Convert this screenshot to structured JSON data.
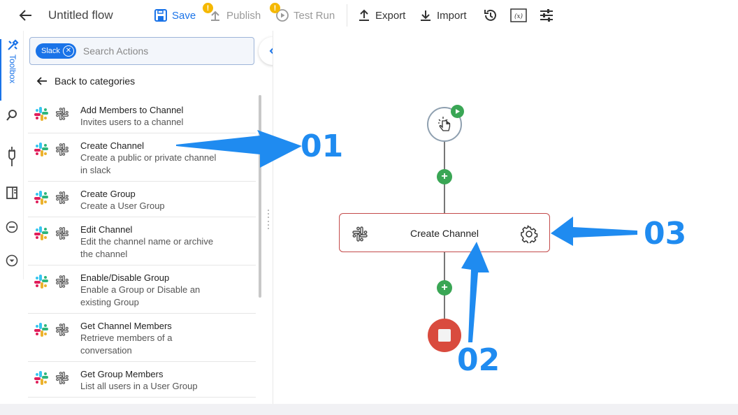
{
  "header": {
    "title": "Untitled flow",
    "save_label": "Save",
    "publish_label": "Publish",
    "test_run_label": "Test Run",
    "export_label": "Export",
    "import_label": "Import",
    "warning_badge": "!"
  },
  "rail": {
    "toolbox_label": "Toolbox"
  },
  "panel": {
    "search": {
      "chip_label": "Slack",
      "placeholder": "Search Actions"
    },
    "back_label": "Back to categories",
    "actions": [
      {
        "name": "Add Members to Channel",
        "desc": [
          "Invites users to a channel"
        ]
      },
      {
        "name": "Create Channel",
        "desc": [
          "Create a public or private channel",
          "in slack"
        ]
      },
      {
        "name": "Create Group",
        "desc": [
          "Create a User Group"
        ]
      },
      {
        "name": "Edit Channel",
        "desc": [
          "Edit the channel name or archive",
          "the channel"
        ]
      },
      {
        "name": "Enable/Disable Group",
        "desc": [
          "Enable a Group or Disable an",
          "existing Group"
        ]
      },
      {
        "name": "Get Channel Members",
        "desc": [
          "Retrieve members of a",
          "conversation"
        ]
      },
      {
        "name": "Get Group Members",
        "desc": [
          "List all users in a User Group"
        ]
      }
    ]
  },
  "canvas": {
    "node_label": "Create Channel",
    "plus_symbol": "+"
  },
  "annotations": {
    "n1": "01",
    "n2": "02",
    "n3": "03"
  },
  "colors": {
    "accent": "#1a73e8",
    "node_border": "#c34a4a",
    "plus": "#3aa655",
    "stop": "#d94b3e",
    "annotation": "#1f8bf0"
  }
}
